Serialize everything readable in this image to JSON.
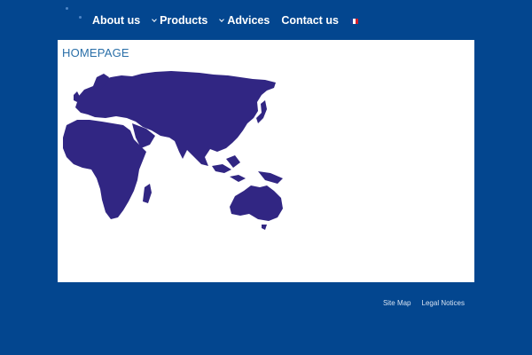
{
  "nav": {
    "items": [
      {
        "label": "About us",
        "has_dropdown": false
      },
      {
        "label": "Products",
        "has_dropdown": true
      },
      {
        "label": "Advices",
        "has_dropdown": true
      },
      {
        "label": "Contact us",
        "has_dropdown": false
      }
    ],
    "language_flag": {
      "icon": "france-flag-icon",
      "colors": [
        "#1c3f94",
        "#ffffff",
        "#d21f2b"
      ]
    }
  },
  "main": {
    "title": "HOMEPAGE",
    "map": {
      "icon": "world-map-icon",
      "color": "#312683"
    }
  },
  "footer": {
    "links": [
      "Site Map",
      "Legal Notices"
    ]
  },
  "colors": {
    "background": "#03468f",
    "content_background": "#ffffff",
    "title": "#2a6fa8",
    "nav_text": "#ffffff"
  }
}
